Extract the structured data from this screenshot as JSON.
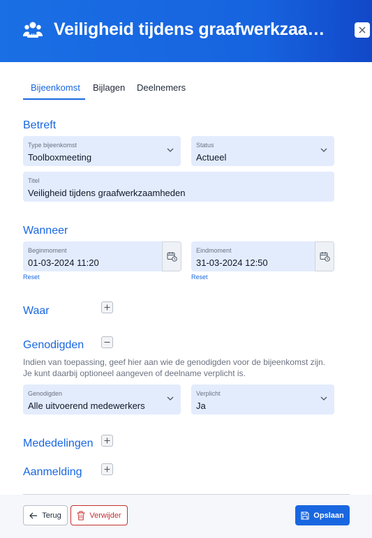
{
  "header": {
    "title": "Veiligheid tijdens graafwerkzaamheden",
    "icon": "group-people-icon",
    "close_icon": "close-icon"
  },
  "tabs": [
    {
      "label": "Bijeenkomst",
      "active": true
    },
    {
      "label": "Bijlagen",
      "active": false
    },
    {
      "label": "Deelnemers",
      "active": false
    }
  ],
  "betreft": {
    "title": "Betreft",
    "type": {
      "label": "Type bijeenkomst",
      "value": "Toolboxmeeting"
    },
    "status": {
      "label": "Status",
      "value": "Actueel"
    },
    "titel": {
      "label": "Titel",
      "value": "Veiligheid tijdens graafwerkzaamheden"
    }
  },
  "wanneer": {
    "title": "Wanneer",
    "begin": {
      "label": "Beginmoment",
      "value": "01-03-2024 11:20",
      "reset": "Reset"
    },
    "eind": {
      "label": "Eindmoment",
      "value": "31-03-2024 12:50",
      "reset": "Reset"
    }
  },
  "waar": {
    "title": "Waar"
  },
  "genodigden": {
    "title": "Genodigden",
    "help_line1": "Indien van toepassing, geef hier aan wie de genodigden voor de bijeenkomst zijn.",
    "help_line2": "Je kunt daarbij optioneel aangeven of deelname verplicht is.",
    "who": {
      "label": "Genodigden",
      "value": "Alle uitvoerend medewerkers"
    },
    "verplicht": {
      "label": "Verplicht",
      "value": "Ja"
    }
  },
  "mededelingen": {
    "title": "Mededelingen"
  },
  "aanmelding": {
    "title": "Aanmelding"
  },
  "footer": {
    "back_label": "Terug",
    "delete_label": "Verwijder",
    "save_label": "Opslaan"
  },
  "colors": {
    "accent": "#1967e0",
    "field_bg": "#e3ecfd",
    "danger": "#c53030"
  }
}
